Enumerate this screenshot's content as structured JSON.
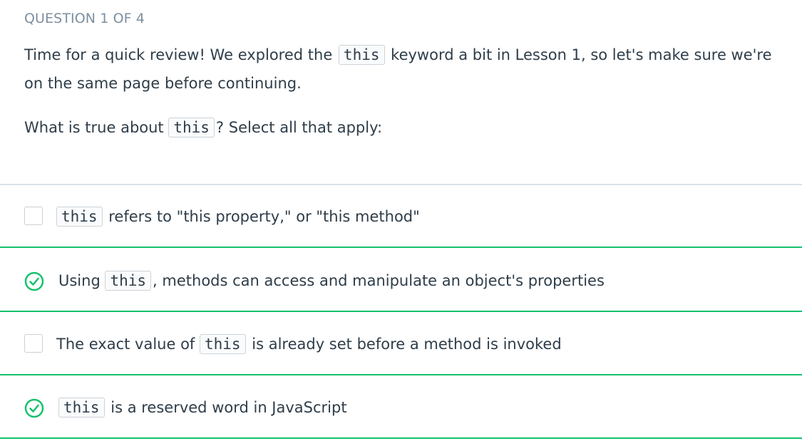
{
  "header": {
    "question_counter": "QUESTION 1 OF 4"
  },
  "prompt": {
    "line1_before": "Time for a quick review! We explored the ",
    "line1_code": "this",
    "line1_after": " keyword a bit in Lesson 1, so let's make sure we're on the same page before continuing.",
    "question_before": "What is true about ",
    "question_code": "this",
    "question_after": "? Select all that apply:"
  },
  "options": [
    {
      "checked": false,
      "before": "",
      "code": "this",
      "after": " refers to \"this property,\" or \"this method\""
    },
    {
      "checked": true,
      "before": "Using ",
      "code": "this",
      "after": ", methods can access and manipulate an object's properties"
    },
    {
      "checked": false,
      "before": "The exact value of ",
      "code": "this",
      "after": " is already set before a method is invoked"
    },
    {
      "checked": true,
      "before": "",
      "code": "this",
      "after": " is a reserved word in JavaScript"
    }
  ],
  "colors": {
    "accent_green": "#15c26b",
    "text": "#2e3d49",
    "muted": "#7d8f9e"
  },
  "icons": {
    "checked": "check-circle-icon",
    "unchecked": "checkbox-empty-icon"
  }
}
